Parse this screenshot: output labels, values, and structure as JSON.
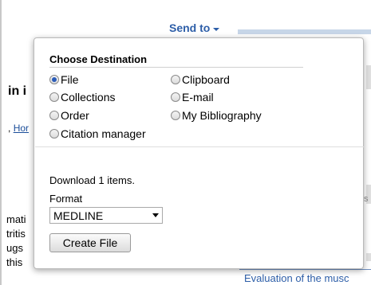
{
  "header": {
    "send_to_label": "Send to"
  },
  "background": {
    "title_fragment": "in i",
    "author_prefix": ",",
    "author_link": "Hor",
    "text_lines": [
      "mati",
      "tritis",
      "ugs",
      "this"
    ],
    "right_item": "Evaluation of the musc",
    "right_fragment": "s"
  },
  "dropdown": {
    "heading": "Choose Destination",
    "destinations": [
      {
        "label": "File",
        "checked": true
      },
      {
        "label": "Clipboard",
        "checked": false
      },
      {
        "label": "Collections",
        "checked": false
      },
      {
        "label": "E-mail",
        "checked": false
      },
      {
        "label": "Order",
        "checked": false
      },
      {
        "label": "My Bibliography",
        "checked": false
      },
      {
        "label": "Citation manager",
        "checked": false
      }
    ],
    "download_text": "Download 1 items.",
    "format_label": "Format",
    "format_selected": "MEDLINE",
    "create_button": "Create File"
  },
  "colors": {
    "link": "#2d5ea8",
    "radio_selected": "#2a5bb8"
  }
}
